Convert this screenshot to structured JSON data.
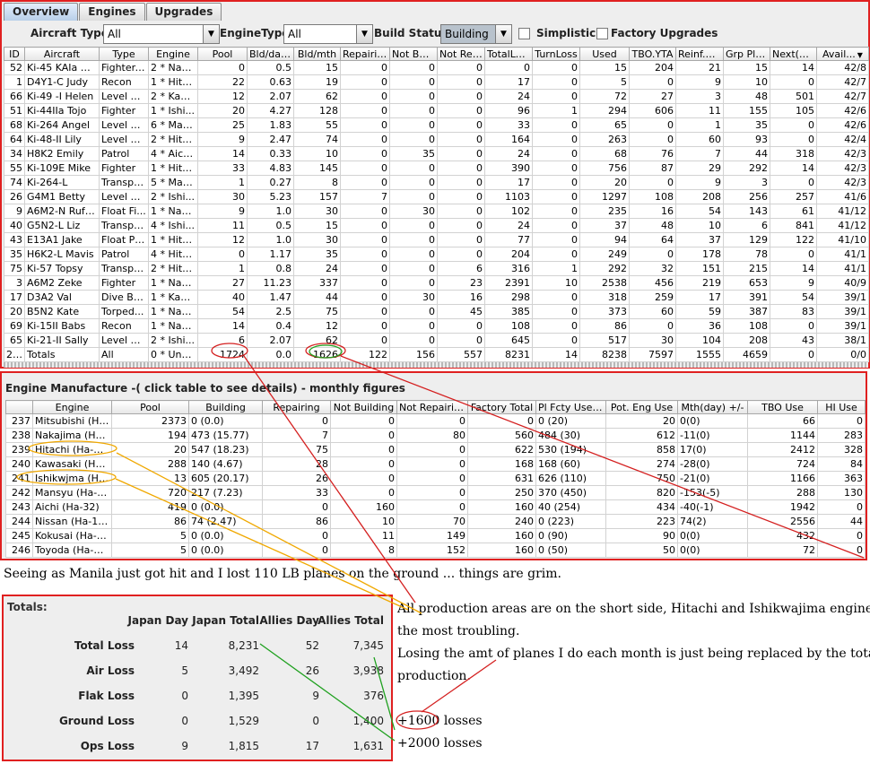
{
  "tabs": [
    {
      "label": "Overview",
      "active": true
    },
    {
      "label": "Engines",
      "active": false
    },
    {
      "label": "Upgrades",
      "active": false
    }
  ],
  "filters": {
    "aircraft_type_label": "Aircraft Type:",
    "aircraft_type_value": "All",
    "engine_type_label": "EngineType:",
    "engine_type_value": "All",
    "build_status_label": "Build Status:",
    "build_status_value": "Building",
    "simplistic_label": "Simplistic",
    "factory_upgrades_label": "Factory Upgrades"
  },
  "aircraft_table": {
    "headers": [
      "ID",
      "Aircraft",
      "Type",
      "Engine",
      "Pool",
      "Bld/days",
      "Bld/mth",
      "Repairing",
      "Not Buil...",
      "Not Rep...",
      "TotalLo...",
      "TurnLoss",
      "Used",
      "TBO.YTA",
      "Reinf.N...",
      "Grp Pla...",
      "Next(dd)",
      "Avail..."
    ],
    "sort_indicator": "▼",
    "rows": [
      [
        "52",
        "Ki-45 KAIa Nick",
        "Fighter-...",
        "2 * Nak...",
        "0",
        "0.5",
        "15",
        "0",
        "0",
        "0",
        "0",
        "0",
        "15",
        "204",
        "21",
        "15",
        "14",
        "42/8"
      ],
      [
        "1",
        "D4Y1-C Judy",
        "Recon",
        "1 * Hita...",
        "22",
        "0.63",
        "19",
        "0",
        "0",
        "0",
        "17",
        "0",
        "5",
        "0",
        "9",
        "10",
        "0",
        "42/7"
      ],
      [
        "66",
        "Ki-49 -I Helen",
        "Level B...",
        "2 * Kaw...",
        "12",
        "2.07",
        "62",
        "0",
        "0",
        "0",
        "24",
        "0",
        "72",
        "27",
        "3",
        "48",
        "501",
        "42/7"
      ],
      [
        "51",
        "Ki-44IIa Tojo",
        "Fighter",
        "1 * Ishi...",
        "20",
        "4.27",
        "128",
        "0",
        "0",
        "0",
        "96",
        "1",
        "294",
        "606",
        "11",
        "155",
        "105",
        "42/6"
      ],
      [
        "68",
        "Ki-264 Angel",
        "Level B...",
        "6 * Man...",
        "25",
        "1.83",
        "55",
        "0",
        "0",
        "0",
        "33",
        "0",
        "65",
        "0",
        "1",
        "35",
        "0",
        "42/6"
      ],
      [
        "64",
        "Ki-48-II Lily",
        "Level B...",
        "2 * Hita...",
        "9",
        "2.47",
        "74",
        "0",
        "0",
        "0",
        "164",
        "0",
        "263",
        "0",
        "60",
        "93",
        "0",
        "42/4"
      ],
      [
        "34",
        "H8K2 Emily",
        "Patrol",
        "4 * Aich...",
        "14",
        "0.33",
        "10",
        "0",
        "35",
        "0",
        "24",
        "0",
        "68",
        "76",
        "7",
        "44",
        "318",
        "42/3"
      ],
      [
        "55",
        "Ki-109E Mike",
        "Fighter",
        "1 * Hita...",
        "33",
        "4.83",
        "145",
        "0",
        "0",
        "0",
        "390",
        "0",
        "756",
        "87",
        "29",
        "292",
        "14",
        "42/3"
      ],
      [
        "74",
        "Ki-264-L",
        "Transport",
        "5 * Man...",
        "1",
        "0.27",
        "8",
        "0",
        "0",
        "0",
        "17",
        "0",
        "20",
        "0",
        "9",
        "3",
        "0",
        "42/3"
      ],
      [
        "26",
        "G4M1 Betty",
        "Level B...",
        "2 * Ishi...",
        "30",
        "5.23",
        "157",
        "7",
        "0",
        "0",
        "1103",
        "0",
        "1297",
        "108",
        "208",
        "256",
        "257",
        "41/6"
      ],
      [
        "9",
        "A6M2-N Rufe-FF",
        "Float Fi...",
        "1 * Nak...",
        "9",
        "1.0",
        "30",
        "0",
        "30",
        "0",
        "102",
        "0",
        "235",
        "16",
        "54",
        "143",
        "61",
        "41/12"
      ],
      [
        "40",
        "G5N2-L Liz",
        "Transport",
        "4 * Ishi...",
        "11",
        "0.5",
        "15",
        "0",
        "0",
        "0",
        "24",
        "0",
        "37",
        "48",
        "10",
        "6",
        "841",
        "41/12"
      ],
      [
        "43",
        "E13A1 Jake",
        "Float Pl...",
        "1 * Hita...",
        "12",
        "1.0",
        "30",
        "0",
        "0",
        "0",
        "77",
        "0",
        "94",
        "64",
        "37",
        "129",
        "122",
        "41/10"
      ],
      [
        "35",
        "H6K2-L Mavis",
        "Patrol",
        "4 * Hita...",
        "0",
        "1.17",
        "35",
        "0",
        "0",
        "0",
        "204",
        "0",
        "249",
        "0",
        "178",
        "78",
        "0",
        "41/1"
      ],
      [
        "75",
        "Ki-57 Topsy",
        "Transport",
        "2 * Hita...",
        "1",
        "0.8",
        "24",
        "0",
        "0",
        "6",
        "316",
        "1",
        "292",
        "32",
        "151",
        "215",
        "14",
        "41/1"
      ],
      [
        "3",
        "A6M2 Zeke",
        "Fighter",
        "1 * Nak...",
        "27",
        "11.23",
        "337",
        "0",
        "0",
        "23",
        "2391",
        "10",
        "2538",
        "456",
        "219",
        "653",
        "9",
        "40/9"
      ],
      [
        "17",
        "D3A2 Val",
        "Dive Bo...",
        "1 * Kaw...",
        "40",
        "1.47",
        "44",
        "0",
        "30",
        "16",
        "298",
        "0",
        "318",
        "259",
        "17",
        "391",
        "54",
        "39/1"
      ],
      [
        "20",
        "B5N2 Kate",
        "Torped...",
        "1 * Nak...",
        "54",
        "2.5",
        "75",
        "0",
        "0",
        "45",
        "385",
        "0",
        "373",
        "60",
        "59",
        "387",
        "83",
        "39/1"
      ],
      [
        "69",
        "Ki-15II Babs",
        "Recon",
        "1 * Nak...",
        "14",
        "0.4",
        "12",
        "0",
        "0",
        "0",
        "108",
        "0",
        "86",
        "0",
        "36",
        "108",
        "0",
        "39/1"
      ],
      [
        "65",
        "Ki-21-II Sally",
        "Level B...",
        "2 * Ishi...",
        "6",
        "2.07",
        "62",
        "0",
        "0",
        "0",
        "645",
        "0",
        "517",
        "30",
        "104",
        "208",
        "43",
        "38/1"
      ],
      [
        "250",
        "Totals",
        "All",
        "0 * Unk...",
        "1724",
        "0.0",
        "1626",
        "122",
        "156",
        "557",
        "8231",
        "14",
        "8238",
        "7597",
        "1555",
        "4659",
        "0",
        "0/0"
      ]
    ]
  },
  "engine_panel": {
    "title": "Engine Manufacture -( click table to see details) - monthly figures",
    "headers": [
      "",
      "Engine",
      "Pool",
      "Building",
      "Repairing",
      "Not Building",
      "Not Repairing",
      "Factory Total",
      "Pl Fcty Use(...",
      "Pot. Eng Use",
      "Mth(day) +/-",
      "TBO Use",
      "HI Use"
    ],
    "rows": [
      [
        "237",
        "Mitsubishi (Ha-1)",
        "2373",
        "0 (0.0)",
        "0",
        "0",
        "0",
        "0",
        "0 (20)",
        "20",
        "0(0)",
        "66",
        "0"
      ],
      [
        "238",
        "Nakajima (Ha-5)",
        "194",
        "473 (15.77)",
        "7",
        "0",
        "80",
        "560",
        "484 (30)",
        "612",
        "-11(0)",
        "1144",
        "283"
      ],
      [
        "239",
        "Hitachi (Ha-35)",
        "20",
        "547 (18.23)",
        "75",
        "0",
        "0",
        "622",
        "530 (194)",
        "858",
        "17(0)",
        "2412",
        "328"
      ],
      [
        "240",
        "Kawasaki (Ha-41)",
        "288",
        "140 (4.67)",
        "28",
        "0",
        "0",
        "168",
        "168 (60)",
        "274",
        "-28(0)",
        "724",
        "84"
      ],
      [
        "241",
        "Ishikwjma (Ha-...",
        "13",
        "605 (20.17)",
        "26",
        "0",
        "0",
        "631",
        "626 (110)",
        "750",
        "-21(0)",
        "1166",
        "363"
      ],
      [
        "242",
        "Mansyu (Ha-45)",
        "720",
        "217 (7.23)",
        "33",
        "0",
        "0",
        "250",
        "370 (450)",
        "820",
        "-153(-5)",
        "288",
        "130"
      ],
      [
        "243",
        "Aichi (Ha-32)",
        "419",
        "0 (0.0)",
        "0",
        "160",
        "0",
        "160",
        "40 (254)",
        "434",
        "-40(-1)",
        "1942",
        "0"
      ],
      [
        "244",
        "Nissan (Ha-104)",
        "86",
        "74 (2.47)",
        "86",
        "10",
        "70",
        "240",
        "0 (223)",
        "223",
        "74(2)",
        "2556",
        "44"
      ],
      [
        "245",
        "Kokusai (Ha-43)",
        "5",
        "0 (0.0)",
        "0",
        "11",
        "149",
        "160",
        "0 (90)",
        "90",
        "0(0)",
        "432",
        "0"
      ],
      [
        "246",
        "Toyoda (Ha-44)",
        "5",
        "0 (0.0)",
        "0",
        "8",
        "152",
        "160",
        "0 (50)",
        "50",
        "0(0)",
        "72",
        "0"
      ]
    ]
  },
  "totals_panel": {
    "title": "Totals:",
    "headers": [
      "Japan Day",
      "Japan Total",
      "Allies Day",
      "Allies Total"
    ],
    "rows": [
      {
        "label": "Total Loss",
        "values": [
          "14",
          "8,231",
          "52",
          "7,345"
        ]
      },
      {
        "label": "Air Loss",
        "values": [
          "5",
          "3,492",
          "26",
          "3,938"
        ]
      },
      {
        "label": "Flak Loss",
        "values": [
          "0",
          "1,395",
          "9",
          "376"
        ]
      },
      {
        "label": "Ground Loss",
        "values": [
          "0",
          "1,529",
          "0",
          "1,400"
        ]
      },
      {
        "label": "Ops Loss",
        "values": [
          "9",
          "1,815",
          "17",
          "1,631"
        ]
      }
    ]
  },
  "notes": {
    "manila": "Seeing as Manila just got hit and I lost 110 LB planes on the ground ... things are grim.",
    "production_line1": "All production areas are on the short side, Hitachi and Ishikwajima engines are",
    "production_line2": "the most troubling.",
    "losing_line1": "Losing the amt of planes I do each month is just being replaced by the total",
    "losing_line2": "production.",
    "loss_1600_num": "+1600",
    "loss_1600_text": "losses",
    "loss_2000": "+2000 losses"
  },
  "annotation_colors": {
    "red": "#d42020",
    "green": "#1ea01e",
    "orange": "#f0a800"
  }
}
